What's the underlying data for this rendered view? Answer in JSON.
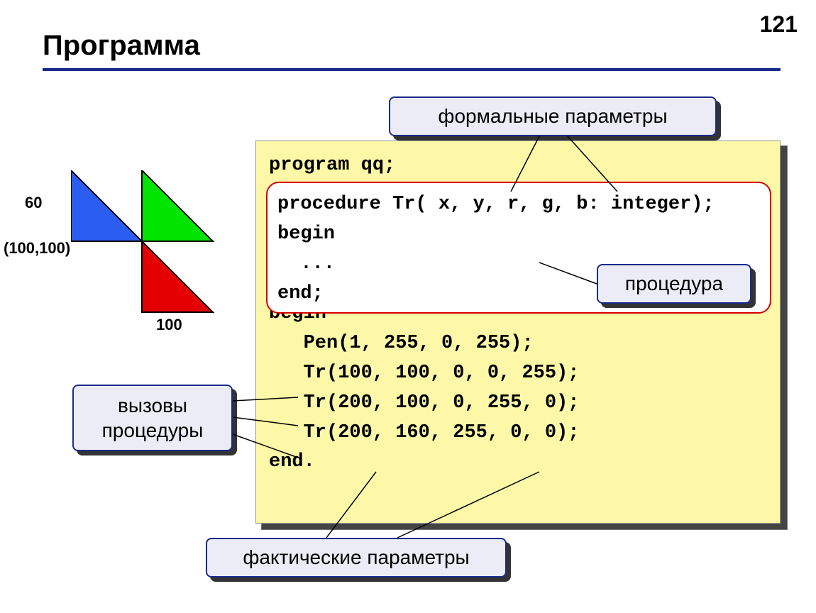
{
  "page_number": "121",
  "title": "Программа",
  "diagram": {
    "label_60": "60",
    "label_origin": "(100,100)",
    "label_100": "100"
  },
  "code": {
    "program_line": "program qq;",
    "procedure_decl": "procedure Tr( x, y, r, g, b: integer);",
    "proc_begin": "begin",
    "proc_body": "  ...",
    "proc_end": "end;",
    "main_begin": "begin",
    "main_l1": "   Pen(1, 255, 0, 255);",
    "main_l2": "   Tr(100, 100, 0, 0, 255);",
    "main_l3": "   Tr(200, 100, 0, 255, 0);",
    "main_l4": "   Tr(200, 160, 255, 0, 0);",
    "main_end": "end."
  },
  "callouts": {
    "formal": "формальные параметры",
    "procedure": "процедура",
    "calls_line1": "вызовы",
    "calls_line2": "процедуры",
    "actual": "фактические параметры"
  }
}
